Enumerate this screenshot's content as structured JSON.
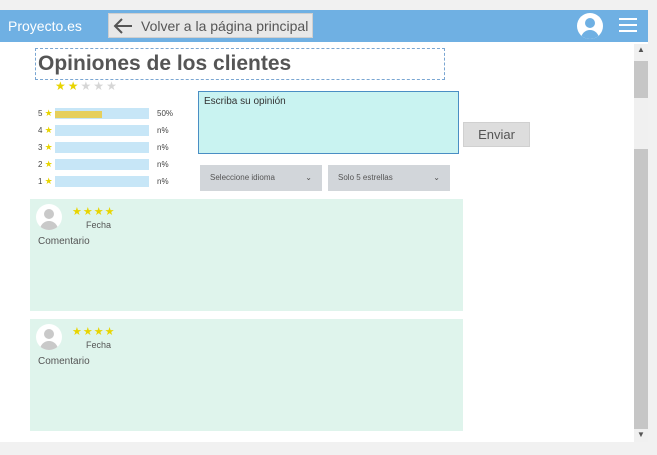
{
  "topbar": {
    "brand": "Proyecto.es",
    "back_label": "Volver a la página principal",
    "avatar_icon": "user-avatar-icon",
    "menu_icon": "hamburger-menu-icon",
    "color": "#6fb0e3"
  },
  "page": {
    "title": "Opiniones de los clientes",
    "average_rating": 2,
    "max_rating": 5
  },
  "ratings": [
    {
      "stars": "5",
      "percent": "50%",
      "fill": 0.5
    },
    {
      "stars": "4",
      "percent": "n%",
      "fill": 0
    },
    {
      "stars": "3",
      "percent": "n%",
      "fill": 0
    },
    {
      "stars": "2",
      "percent": "n%",
      "fill": 0
    },
    {
      "stars": "1",
      "percent": "n%",
      "fill": 0
    }
  ],
  "form": {
    "placeholder": "Escriba su opinión",
    "send_label": "Enviar",
    "language_select": "Seleccione idioma",
    "stars_filter": "Solo 5 estrellas"
  },
  "reviews": [
    {
      "stars": 4,
      "date": "Fecha",
      "comment": "Comentario"
    },
    {
      "stars": 4,
      "date": "Fecha",
      "comment": "Comentario"
    }
  ],
  "star_icon": "★",
  "colors": {
    "star": "#e8d400",
    "review_bg": "#dff4ec",
    "opinion_bg": "#c9f3f1",
    "bar_bg": "#c7e6f7",
    "bar_fill": "#e6cf5c"
  }
}
